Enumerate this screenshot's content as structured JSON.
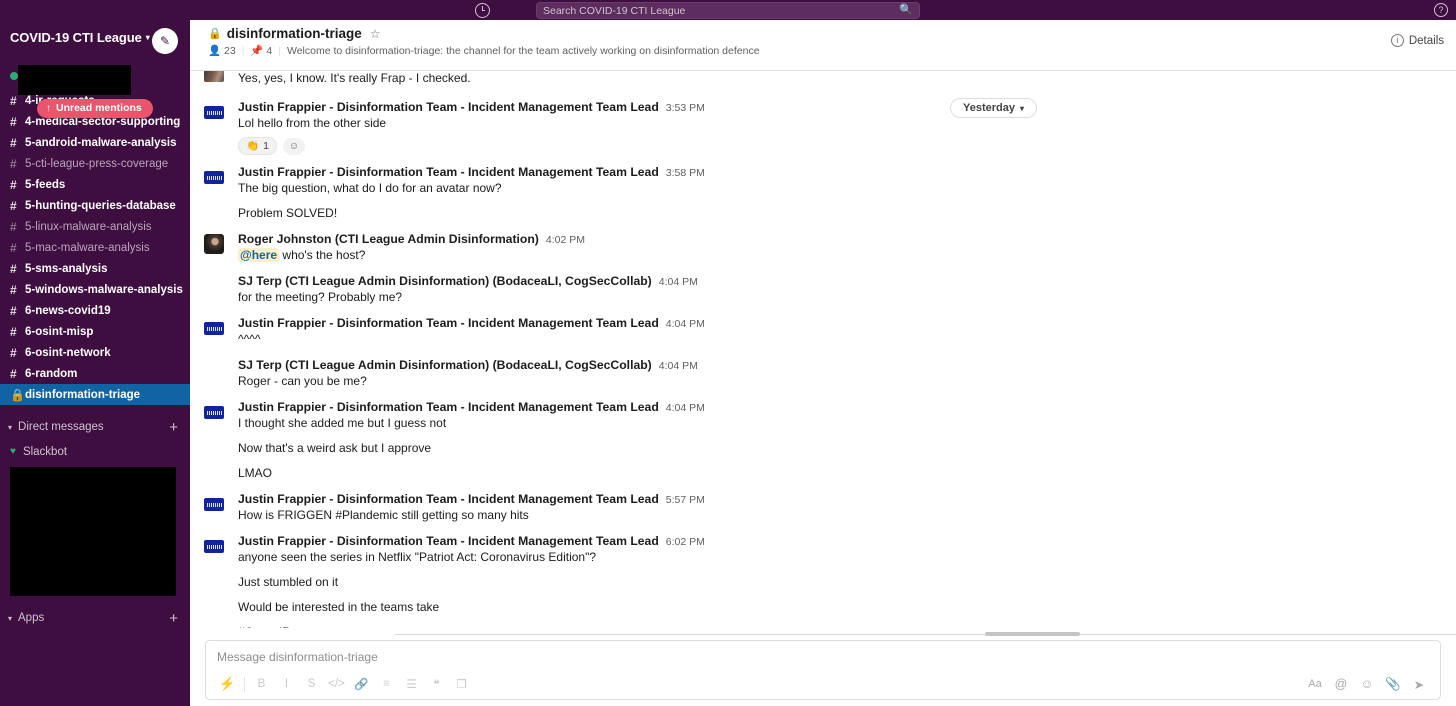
{
  "topbar": {
    "history_icon": "clock-icon",
    "search_placeholder": "Search COVID-19 CTI League",
    "search_icon": "search-icon",
    "help_icon": "question-mark-icon",
    "help_label": "?"
  },
  "sidebar": {
    "workspace_name": "COVID-19 CTI League",
    "workspace_chevron": "▾",
    "compose_icon": "compose-pencil-icon",
    "user_status": "online",
    "user_name_redacted": "",
    "unread_mentions": {
      "label": "Unread mentions",
      "arrow": "↑"
    },
    "channels": [
      {
        "name": "4-ir-requests",
        "hash": "#",
        "state": "unread"
      },
      {
        "name": "4-medical-sector-supporting",
        "hash": "#",
        "state": "unread"
      },
      {
        "name": "5-android-malware-analysis",
        "hash": "#",
        "state": "unread"
      },
      {
        "name": "5-cti-league-press-coverage",
        "hash": "#",
        "state": "read"
      },
      {
        "name": "5-feeds",
        "hash": "#",
        "state": "unread"
      },
      {
        "name": "5-hunting-queries-database",
        "hash": "#",
        "state": "unread"
      },
      {
        "name": "5-linux-malware-analysis",
        "hash": "#",
        "state": "read"
      },
      {
        "name": "5-mac-malware-analysis",
        "hash": "#",
        "state": "read"
      },
      {
        "name": "5-sms-analysis",
        "hash": "#",
        "state": "unread"
      },
      {
        "name": "5-windows-malware-analysis",
        "hash": "#",
        "state": "unread"
      },
      {
        "name": "6-news-covid19",
        "hash": "#",
        "state": "unread"
      },
      {
        "name": "6-osint-misp",
        "hash": "#",
        "state": "unread"
      },
      {
        "name": "6-osint-network",
        "hash": "#",
        "state": "unread"
      },
      {
        "name": "6-random",
        "hash": "#",
        "state": "unread"
      },
      {
        "name": "disinformation-triage",
        "hash": "🔒",
        "state": "active"
      }
    ],
    "dm_section": {
      "label": "Direct messages",
      "chevron": "▾",
      "plus": "+"
    },
    "dm_items": [
      {
        "name": "Slackbot",
        "presence": "heart"
      }
    ],
    "apps_section": {
      "label": "Apps",
      "chevron": "▾",
      "plus": "+"
    }
  },
  "channel_header": {
    "lock_icon": "lock-icon",
    "name": "disinformation-triage",
    "star_icon": "star-icon",
    "members_icon": "person-icon",
    "members_count": "23",
    "pins_icon": "pin-icon",
    "pins_count": "4",
    "topic": "Welcome to disinformation-triage: the channel for the team actively working on disinformation defence",
    "details_icon": "info-icon",
    "details_label": "Details"
  },
  "date_divider": {
    "label": "Yesterday",
    "chevron": "▾"
  },
  "partial_message": {
    "text": "Yes, yes, I know. It's really Frap - I checked."
  },
  "messages": [
    {
      "author": "Justin Frappier - Disinformation Team - Incident Management Team Lead",
      "time": "3:53 PM",
      "avatar": "banner",
      "lines": [
        "Lol hello from the other side"
      ],
      "reaction": {
        "emoji": "👏",
        "count": "1"
      }
    },
    {
      "author": "Justin Frappier - Disinformation Team - Incident Management Team Lead",
      "time": "3:58 PM",
      "avatar": "banner",
      "lines": [
        "The big question, what do I do for an avatar now?",
        "Problem SOLVED!"
      ]
    },
    {
      "author": "Roger Johnston (CTI League Admin Disinformation)",
      "time": "4:02 PM",
      "avatar": "roger",
      "mention": "@here",
      "lines": [
        " who's the host?"
      ]
    },
    {
      "author": "SJ Terp (CTI League Admin Disinformation) (BodaceaLI, CogSecCollab)",
      "time": "4:04 PM",
      "avatar": "sj",
      "lines": [
        "for the meeting?  Probably me?"
      ]
    },
    {
      "author": "Justin Frappier - Disinformation Team - Incident Management Team Lead",
      "time": "4:04 PM",
      "avatar": "banner",
      "lines": [
        "^^^^"
      ]
    },
    {
      "author": "SJ Terp (CTI League Admin Disinformation) (BodaceaLI, CogSecCollab)",
      "time": "4:04 PM",
      "avatar": "sj",
      "lines": [
        "Roger - can you be me?"
      ]
    },
    {
      "author": "Justin Frappier - Disinformation Team - Incident Management Team Lead",
      "time": "4:04 PM",
      "avatar": "banner",
      "lines": [
        "I thought she added me but I guess not",
        "Now that's a weird ask but I approve",
        "LMAO"
      ]
    },
    {
      "author": "Justin Frappier - Disinformation Team - Incident Management Team Lead",
      "time": "5:57 PM",
      "avatar": "banner",
      "lines": [
        "How is FRIGGEN #Plandemic still getting so many hits"
      ]
    },
    {
      "author": "Justin Frappier - Disinformation Team - Incident Management Team Lead",
      "time": "6:02 PM",
      "avatar": "banner",
      "lines": [
        "anyone seen the series in Netflix \"Patriot Act: Coronavirus Edition\"?",
        "Just stumbled on it",
        "Would be interested in the teams take",
        "#CancelRent"
      ]
    }
  ],
  "composer": {
    "placeholder": "Message disinformation-triage",
    "format_buttons": [
      {
        "icon": "lightning-icon",
        "label": "⚡"
      },
      {
        "icon": "bold-icon",
        "label": "B"
      },
      {
        "icon": "italic-icon",
        "label": "I"
      },
      {
        "icon": "strikethrough-icon",
        "label": "S"
      },
      {
        "icon": "code-icon",
        "label": "</>"
      },
      {
        "icon": "link-icon",
        "label": "🔗"
      },
      {
        "icon": "ordered-list-icon",
        "label": "≡"
      },
      {
        "icon": "bulleted-list-icon",
        "label": "☰"
      },
      {
        "icon": "blockquote-icon",
        "label": "❝"
      },
      {
        "icon": "code-block-icon",
        "label": "❐"
      }
    ],
    "right_buttons": [
      {
        "icon": "font-format-icon",
        "label": "Aa"
      },
      {
        "icon": "mention-icon",
        "label": "@"
      },
      {
        "icon": "emoji-icon",
        "label": "☺"
      },
      {
        "icon": "attachment-icon",
        "label": "📎"
      },
      {
        "icon": "send-icon",
        "label": "➤"
      }
    ]
  },
  "colors": {
    "sidebar_bg": "#3f0e40",
    "active_channel": "#1164a3",
    "unread_badge": "#e8556d",
    "presence_green": "#2bac76",
    "mention_highlight": "#fdf0c4"
  }
}
